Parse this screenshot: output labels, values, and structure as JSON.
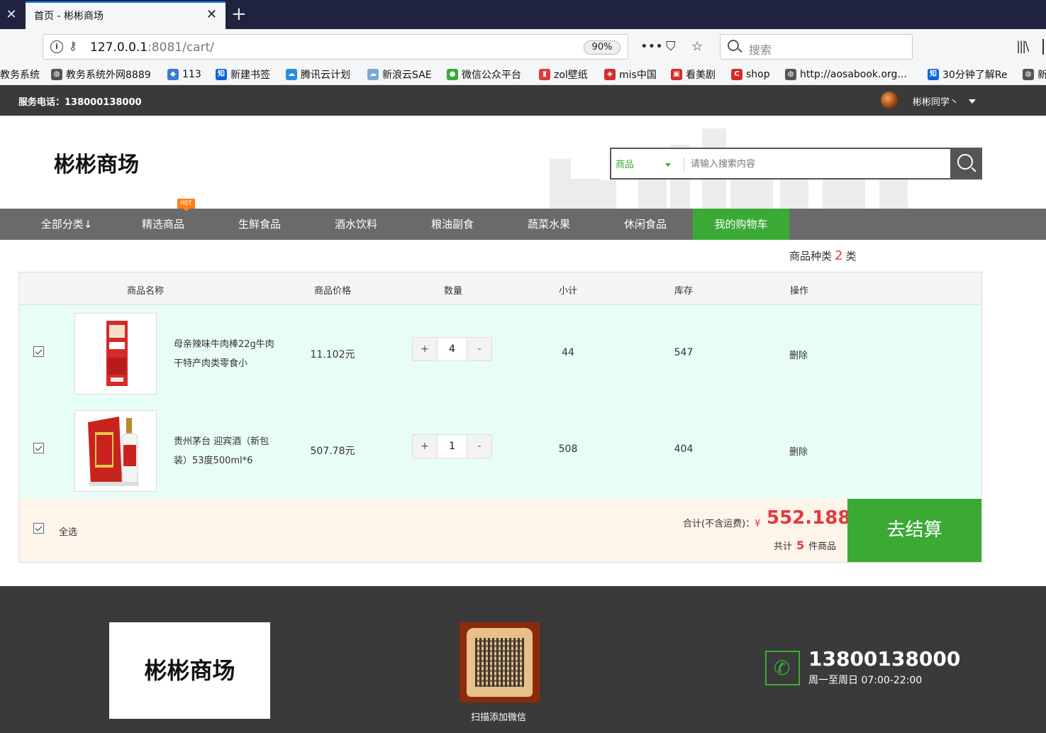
{
  "browser": {
    "tab_title": "首页 - 彬彬商场",
    "url_host": "127.0.0.1",
    "url_rest": ":8081/cart/",
    "zoom": "90%",
    "search_placeholder": "搜索",
    "bookmarks": [
      {
        "label": "教务系统",
        "icon": "globe-icon",
        "color": "#555555"
      },
      {
        "label": "教务系统外网8889",
        "icon": "globe-icon",
        "color": "#555555"
      },
      {
        "label": "113",
        "icon": "cube-icon",
        "color": "#3b7bd6"
      },
      {
        "label": "新建书签",
        "icon": "zhihu-icon",
        "color": "#0a66d8"
      },
      {
        "label": "腾讯云计划",
        "icon": "cloud-icon",
        "color": "#2a8ce0"
      },
      {
        "label": "新浪云SAE",
        "icon": "cloud-icon",
        "color": "#7aa7d6"
      },
      {
        "label": "微信公众平台",
        "icon": "wechat-icon",
        "color": "#3aaa35"
      },
      {
        "label": "zol壁纸",
        "icon": "zol-icon",
        "color": "#e03a3a"
      },
      {
        "label": "mis中国",
        "icon": "shield-icon",
        "color": "#d62b2b"
      },
      {
        "label": "看美剧",
        "icon": "tv-icon",
        "color": "#d62b2b"
      },
      {
        "label": "shop",
        "icon": "c-logo-icon",
        "color": "#d62b2b"
      },
      {
        "label": "http://aosabook.org...",
        "icon": "globe-icon",
        "color": "#555555"
      },
      {
        "label": "30分钟了解Re",
        "icon": "zhihu-icon",
        "color": "#0a66d8"
      },
      {
        "label": "新",
        "icon": "globe-icon",
        "color": "#555555"
      }
    ]
  },
  "topbar": {
    "service": "服务电话：138000138000",
    "username": "彬彬同学丶"
  },
  "header": {
    "logo": "彬彬商场",
    "search_category": "商品",
    "search_placeholder": "请输入搜索内容"
  },
  "catnav": {
    "hot_badge": "HOT",
    "items": [
      "全部分类↓",
      "精选商品",
      "生鲜食品",
      "酒水饮料",
      "粮油副食",
      "蔬菜水果",
      "休闲食品",
      "我的购物车"
    ]
  },
  "cart": {
    "kind_label": "商品种类",
    "kind_count": "2",
    "kind_unit": "类",
    "headers": [
      "商品名称",
      "商品价格",
      "数量",
      "小计",
      "库存",
      "操作"
    ],
    "rows": [
      {
        "name": "母亲辣味牛肉棒22g牛肉干特产肉类零食小",
        "price": "11.102元",
        "qty": "4",
        "subtotal": "44",
        "stock": "547",
        "action": "删除"
      },
      {
        "name": "贵州茅台 迎宾酒（新包装）53度500ml*6",
        "price": "507.78元",
        "qty": "1",
        "subtotal": "508",
        "stock": "404",
        "action": "删除"
      }
    ],
    "plus": "+",
    "minus": "-",
    "select_all": "全选",
    "total_label": "合计(不含运费)：",
    "yen": "¥",
    "total": "552.188",
    "count_prefix": "共计",
    "count": "5",
    "count_suffix": "件商品",
    "checkout": "去结算"
  },
  "footer": {
    "logo": "彬彬商场",
    "qr_caption": "扫描添加微信",
    "phone": "13800138000",
    "hours": "周一至周日 07:00-22:00"
  },
  "colors": {
    "accent": "#3aaa35",
    "price": "#e4393c",
    "hot": "#ff7f1a"
  }
}
